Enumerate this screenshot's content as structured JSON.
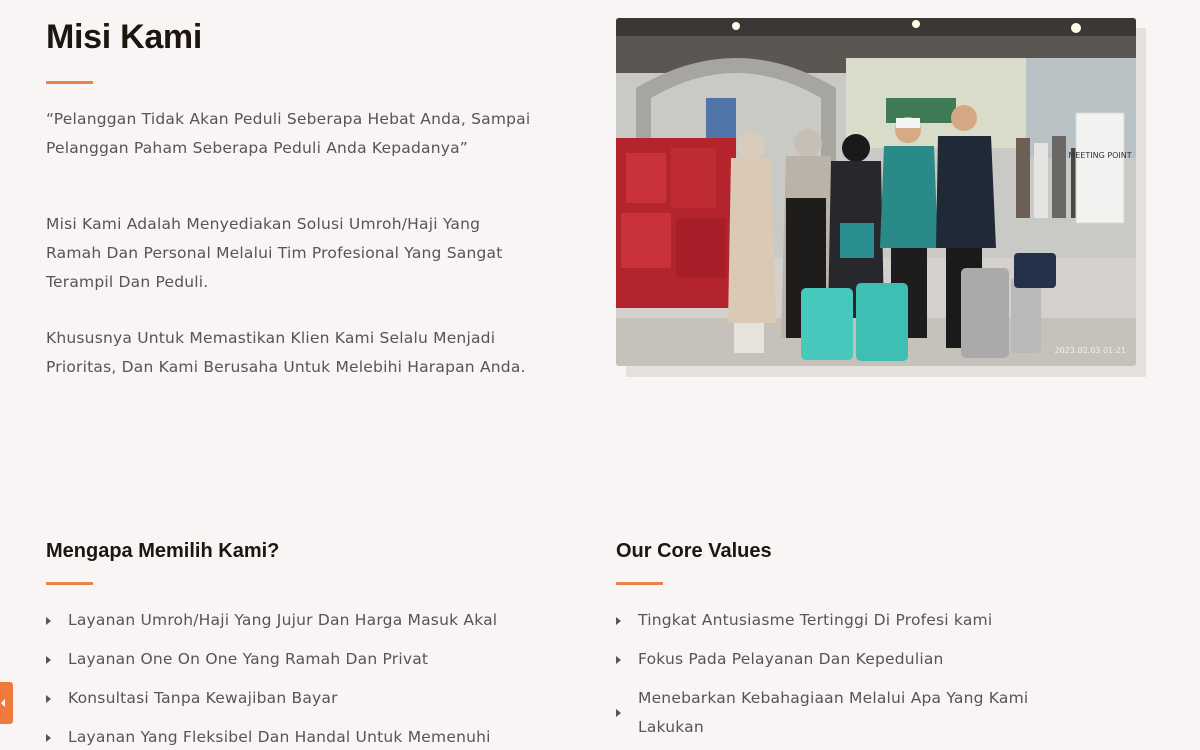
{
  "mission": {
    "title": "Misi Kami",
    "quote": "“Pelanggan Tidak Akan Peduli Seberapa Hebat Anda, Sampai Pelanggan Paham Seberapa Peduli Anda Kepadanya”",
    "paragraph1": "Misi Kami Adalah Menyediakan Solusi Umroh/Haji Yang Ramah Dan Personal Melalui Tim Profesional Yang Sangat Terampil Dan Peduli.",
    "paragraph2": "Khususnya Untuk Memastikan Klien Kami Selalu Menjadi Prioritas, Dan Kami Berusaha Untuk Melebihi Harapan Anda."
  },
  "photo": {
    "banner_text": "MEETING POINT",
    "timestamp": "2023.02.03 01:21"
  },
  "why_us": {
    "title": "Mengapa Memilih Kami?",
    "items": [
      "Layanan Umroh/Haji Yang Jujur Dan Harga Masuk Akal",
      "Layanan One On One Yang Ramah Dan Privat",
      "Konsultasi Tanpa Kewajiban Bayar",
      "Layanan Yang Fleksibel Dan Handal Untuk Memenuhi"
    ]
  },
  "core_values": {
    "title": "Our Core Values",
    "items": [
      "Tingkat Antusiasme Tertinggi Di Profesi kami",
      "Fokus Pada Pelayanan Dan Kepedulian",
      "Menebarkan Kebahagiaan Melalui Apa Yang Kami Lakukan"
    ]
  },
  "colors": {
    "accent": "#e8834c",
    "heading": "#1c1510",
    "body_text": "#555555",
    "background": "#f8f5f4",
    "float_tab": "#f07a3d"
  }
}
